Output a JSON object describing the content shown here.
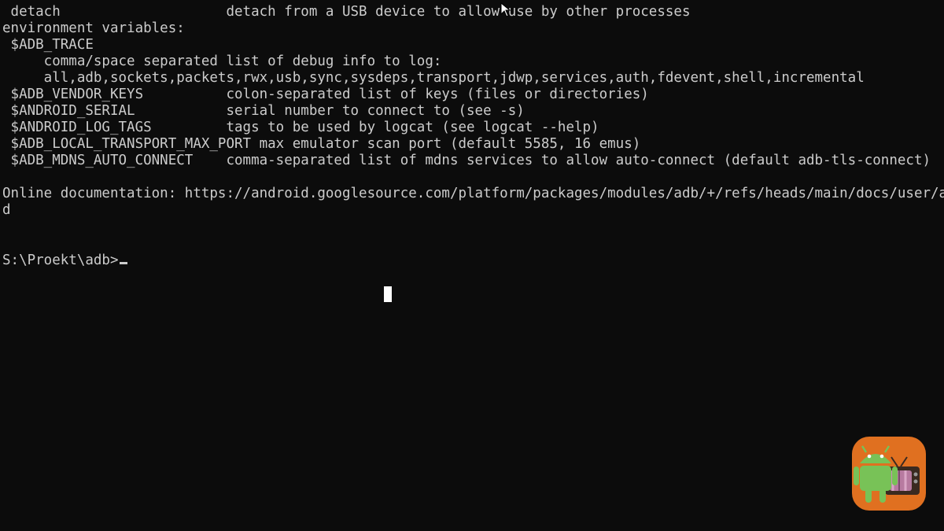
{
  "terminal": {
    "lines": [
      " detach                    detach from a USB device to allow use by other processes",
      "environment variables:",
      " $ADB_TRACE",
      "     comma/space separated list of debug info to log:",
      "     all,adb,sockets,packets,rwx,usb,sync,sysdeps,transport,jdwp,services,auth,fdevent,shell,incremental",
      " $ADB_VENDOR_KEYS          colon-separated list of keys (files or directories)",
      " $ANDROID_SERIAL           serial number to connect to (see -s)",
      " $ANDROID_LOG_TAGS         tags to be used by logcat (see logcat --help)",
      " $ADB_LOCAL_TRANSPORT_MAX_PORT max emulator scan port (default 5585, 16 emus)",
      " $ADB_MDNS_AUTO_CONNECT    comma-separated list of mdns services to allow auto-connect (default adb-tls-connect)",
      "",
      "Online documentation: https://android.googlesource.com/platform/packages/modules/adb/+/refs/heads/main/docs/user/a",
      "d",
      "",
      "",
      "S:\\Proekt\\adb>"
    ]
  },
  "colors": {
    "background": "#0c0c0c",
    "text": "#cccccc",
    "logo_bg": "#e07020",
    "android_green": "#78c257"
  },
  "icons": {
    "pointer": "mouse-pointer-icon",
    "ibeam": "text-cursor-icon",
    "logo": "android-tv-logo-icon"
  }
}
